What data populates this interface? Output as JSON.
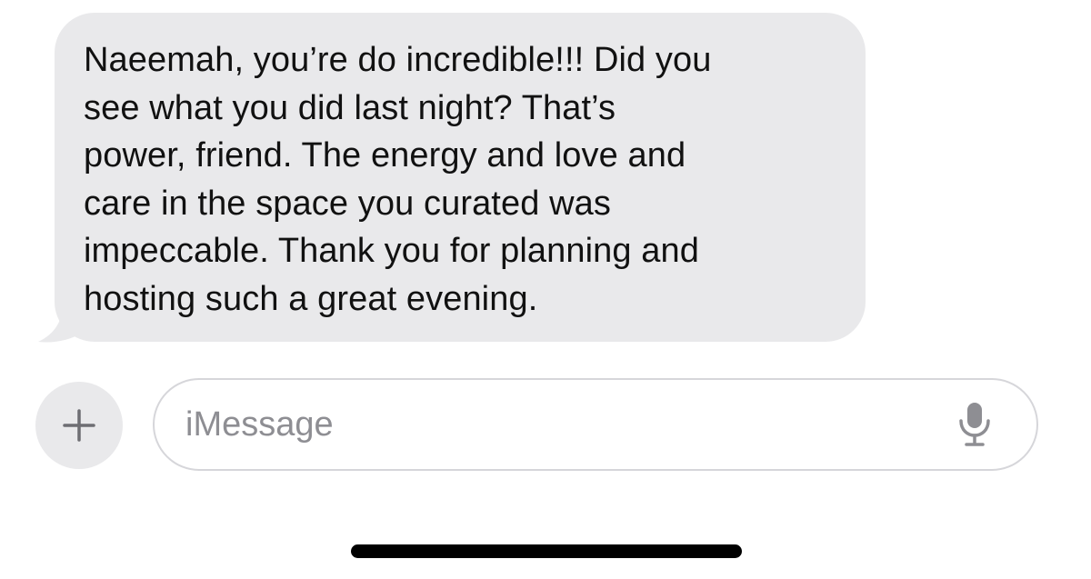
{
  "conversation": {
    "received_message": "Naeemah, you’re do incredible!!! Did you\nsee what you did last night? That’s\npower, friend. The energy and love and\ncare in the space you curated was\nimpeccable. Thank you for planning and\nhosting such a great evening."
  },
  "composer": {
    "placeholder": "iMessage",
    "add_icon": "plus-icon",
    "mic_icon": "microphone-icon"
  },
  "colors": {
    "received_bubble": "#e9e9eb",
    "placeholder_text": "#8e8e93",
    "input_border": "#d6d6da"
  }
}
